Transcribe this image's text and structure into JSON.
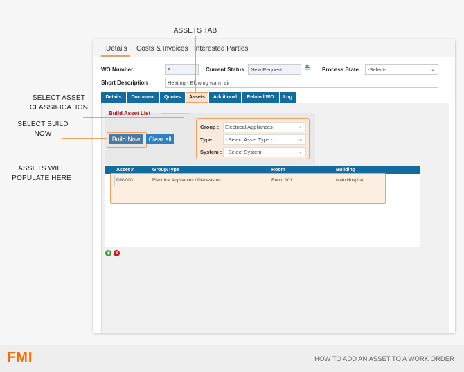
{
  "annotations": {
    "assets_tab": "ASSETS TAB",
    "select_classification": [
      "SELECT ASSET",
      "CLASSIFICATION"
    ],
    "select_build": [
      "SELECT BUILD",
      "NOW"
    ],
    "assets_populate": [
      "ASSETS WILL",
      "POPULATE HERE"
    ]
  },
  "top_tabs": [
    "Details",
    "Costs & Invoices",
    "Interested Parties"
  ],
  "form": {
    "wo_number_label": "WO Number",
    "wo_number": "9",
    "current_status_label": "Current Status",
    "current_status": "New Request",
    "process_state_label": "Process State",
    "process_state": "-Select-",
    "short_desc_label": "Short Description",
    "short_desc": "Heating - Blowing warm air"
  },
  "sub_tabs": [
    "Details",
    "Document",
    "Quotes",
    "Assets",
    "Additional",
    "Related WO",
    "Log"
  ],
  "build": {
    "title": "Build Asset List",
    "build_now": "Build Now",
    "clear_all": "Clear all",
    "group_label": "Group :",
    "group_value": "Electrical Appliances",
    "type_label": "Type :",
    "type_value": "- Select Asset Type -",
    "system_label": "System :",
    "system_value": "- Select System -"
  },
  "table": {
    "headers": [
      "Asset #",
      "Group/Type",
      "Room",
      "Building"
    ],
    "rows": [
      [
        "DW-0001",
        "Electrical Appliances / Dishwasher",
        "Room 101",
        "Main Hospital"
      ]
    ]
  },
  "footer": {
    "logo": "FMI",
    "caption": "HOW TO ADD AN ASSET TO A WORK ORDER"
  },
  "colors": {
    "accent": "#f0a060",
    "tab_blue": "#136b9e",
    "logo": "#ff6a00",
    "title_red": "#a3141c"
  }
}
